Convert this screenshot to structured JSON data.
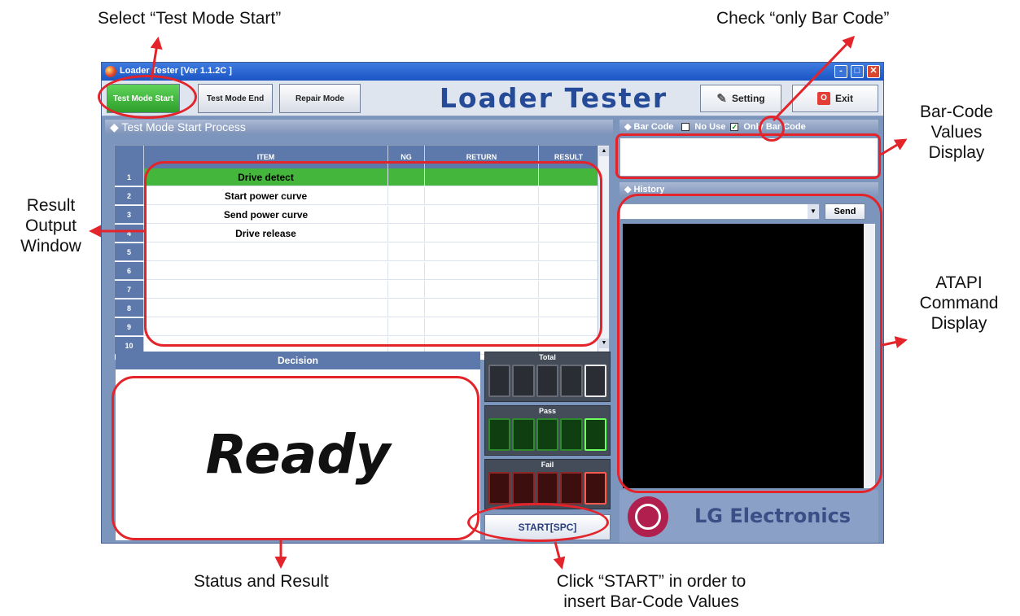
{
  "annotations": {
    "select_test_mode_start": "Select “Test Mode Start”",
    "check_only_bar_code": "Check “only Bar Code”",
    "bar_code_values_display": [
      "Bar-Code",
      "Values",
      "Display"
    ],
    "result_output_window": [
      "Result",
      "Output",
      "Window"
    ],
    "atapi_command_display": [
      "ATAPI",
      "Command",
      "Display"
    ],
    "status_and_result": "Status and Result",
    "click_start": [
      "Click “START” in order to",
      "insert Bar-Code Values"
    ]
  },
  "window": {
    "title": "Loader Tester [Ver 1.1.2C ]",
    "controls": [
      "-",
      "□",
      "✕"
    ]
  },
  "toolbar": {
    "mode_buttons": [
      "Test Mode Start",
      "Test Mode End",
      "Repair Mode"
    ],
    "app_title": "Loader Tester",
    "setting_label": "Setting",
    "exit_label": "Exit",
    "exit_icon_glyph": "O"
  },
  "process_panel": {
    "header": "◆ Test Mode Start Process",
    "columns": [
      "ITEM",
      "NG",
      "RETURN",
      "RESULT"
    ],
    "rows": [
      {
        "num": "1",
        "item": "Drive detect",
        "highlighted": true
      },
      {
        "num": "2",
        "item": "Start power curve"
      },
      {
        "num": "3",
        "item": "Send power curve"
      },
      {
        "num": "4",
        "item": "Drive release"
      },
      {
        "num": "5",
        "item": ""
      },
      {
        "num": "6",
        "item": ""
      },
      {
        "num": "7",
        "item": ""
      },
      {
        "num": "8",
        "item": ""
      },
      {
        "num": "9",
        "item": ""
      },
      {
        "num": "10",
        "item": ""
      }
    ]
  },
  "decision": {
    "header": "Decision",
    "status": "Ready"
  },
  "counters": {
    "total_label": "Total",
    "pass_label": "Pass",
    "fail_label": "Fail"
  },
  "start_button": "START[SPC]",
  "barcode_panel": {
    "header": "◆ Bar Code",
    "no_use_label": "No Use",
    "only_bar_code_label": "Only Bar Code",
    "only_bar_code_checked": true
  },
  "history_panel": {
    "header": "◆ History",
    "send_label": "Send"
  },
  "brand": {
    "name": "LG Electronics"
  },
  "colors": {
    "callout_red": "#e3242b",
    "active_mode_green": "#45b63c",
    "title_blue": "#244a98"
  }
}
